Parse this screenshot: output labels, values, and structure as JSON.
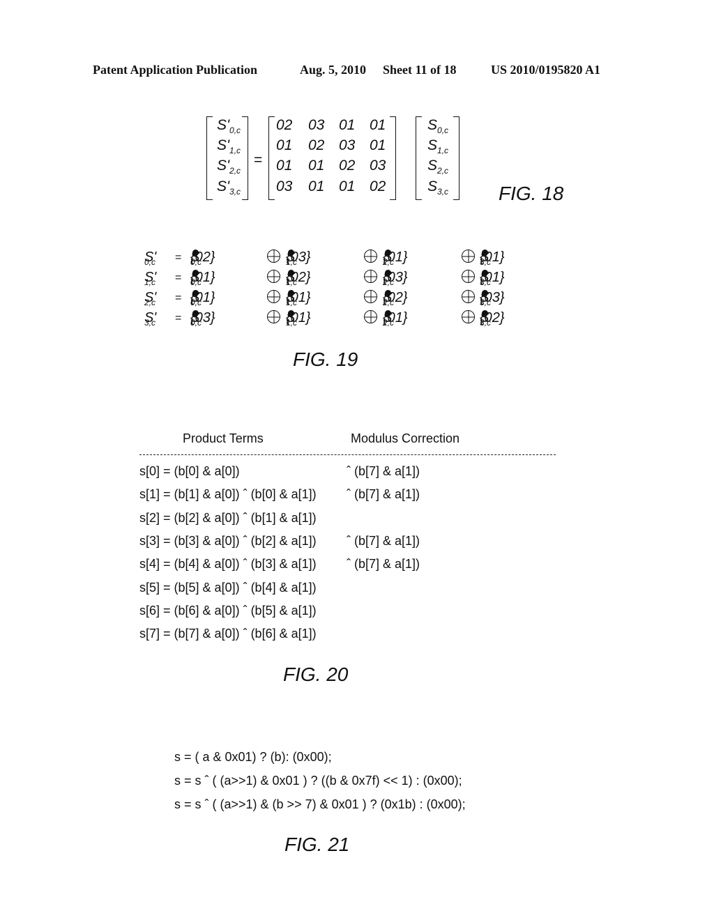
{
  "header": {
    "publication": "Patent Application Publication",
    "date": "Aug. 5, 2010",
    "sheet": "Sheet 11 of 18",
    "number": "US 2010/0195820 A1"
  },
  "fig18": {
    "label": "FIG. 18",
    "equals": "=",
    "lhs": [
      {
        "base": "S'",
        "sub": "0,c"
      },
      {
        "base": "S'",
        "sub": "1,c"
      },
      {
        "base": "S'",
        "sub": "2,c"
      },
      {
        "base": "S'",
        "sub": "3,c"
      }
    ],
    "matrix": [
      [
        "02",
        "03",
        "01",
        "01"
      ],
      [
        "01",
        "02",
        "03",
        "01"
      ],
      [
        "01",
        "01",
        "02",
        "03"
      ],
      [
        "03",
        "01",
        "01",
        "02"
      ]
    ],
    "rhs": [
      {
        "base": "S",
        "sub": "0,c"
      },
      {
        "base": "S",
        "sub": "1,c"
      },
      {
        "base": "S",
        "sub": "2,c"
      },
      {
        "base": "S",
        "sub": "3,c"
      }
    ]
  },
  "fig19": {
    "label": "FIG. 19",
    "equals": "=",
    "rows": [
      {
        "lhs": {
          "base": "S'",
          "sub": "0,c"
        },
        "terms": [
          {
            "coef": "{02}",
            "base": "S",
            "sub": "0,c"
          },
          {
            "coef": "{03}",
            "base": "S",
            "sub": "1,c"
          },
          {
            "coef": "{01}",
            "base": "S",
            "sub": "2,c"
          },
          {
            "coef": "{01}",
            "base": "S",
            "sub": "3,c"
          }
        ]
      },
      {
        "lhs": {
          "base": "S'",
          "sub": "1,c"
        },
        "terms": [
          {
            "coef": "{01}",
            "base": "S",
            "sub": "0,c"
          },
          {
            "coef": "{02}",
            "base": "S",
            "sub": "1,c"
          },
          {
            "coef": "{03}",
            "base": "S",
            "sub": "2,c"
          },
          {
            "coef": "{01}",
            "base": "S",
            "sub": "3,c"
          }
        ]
      },
      {
        "lhs": {
          "base": "S'",
          "sub": "2,c"
        },
        "terms": [
          {
            "coef": "{01}",
            "base": "S",
            "sub": "0,c"
          },
          {
            "coef": "{01}",
            "base": "S",
            "sub": "1,c"
          },
          {
            "coef": "{02}",
            "base": "S",
            "sub": "2,c"
          },
          {
            "coef": "{03}",
            "base": "S",
            "sub": "3,c"
          }
        ]
      },
      {
        "lhs": {
          "base": "S'",
          "sub": "3,c"
        },
        "terms": [
          {
            "coef": "{03}",
            "base": "S",
            "sub": "0,c"
          },
          {
            "coef": "{01}",
            "base": "S",
            "sub": "1,c"
          },
          {
            "coef": "{01}",
            "base": "S",
            "sub": "2,c"
          },
          {
            "coef": "{02}",
            "base": "S",
            "sub": "3,c"
          }
        ]
      }
    ]
  },
  "fig20": {
    "label": "FIG. 20",
    "headers": [
      "Product Terms",
      "Modulus Correction"
    ],
    "rows": [
      {
        "product": "s[0] = (b[0] & a[0])",
        "correction": "ˆ  (b[7] & a[1])"
      },
      {
        "product": "s[1] = (b[1] & a[0]) ˆ (b[0] & a[1])",
        "correction": "ˆ  (b[7] & a[1])"
      },
      {
        "product": "s[2] = (b[2] & a[0]) ˆ (b[1] & a[1])",
        "correction": ""
      },
      {
        "product": "s[3] = (b[3] & a[0]) ˆ (b[2] & a[1])",
        "correction": "ˆ  (b[7] & a[1])"
      },
      {
        "product": "s[4] = (b[4] & a[0]) ˆ (b[3] & a[1])",
        "correction": "ˆ  (b[7] & a[1])"
      },
      {
        "product": "s[5] = (b[5] & a[0]) ˆ (b[4] & a[1])",
        "correction": ""
      },
      {
        "product": "s[6] = (b[6] & a[0]) ˆ (b[5] & a[1])",
        "correction": ""
      },
      {
        "product": "s[7] = (b[7] & a[0]) ˆ (b[6] & a[1])",
        "correction": ""
      }
    ]
  },
  "fig21": {
    "label": "FIG. 21",
    "lines": [
      "s = ( a & 0x01) ? (b): (0x00);",
      "s = s ˆ ( (a>>1) & 0x01 ) ? ((b & 0x7f) << 1) : (0x00);",
      "s = s ˆ ( (a>>1) & (b >> 7) & 0x01 ) ? (0x1b) : (0x00);"
    ]
  }
}
